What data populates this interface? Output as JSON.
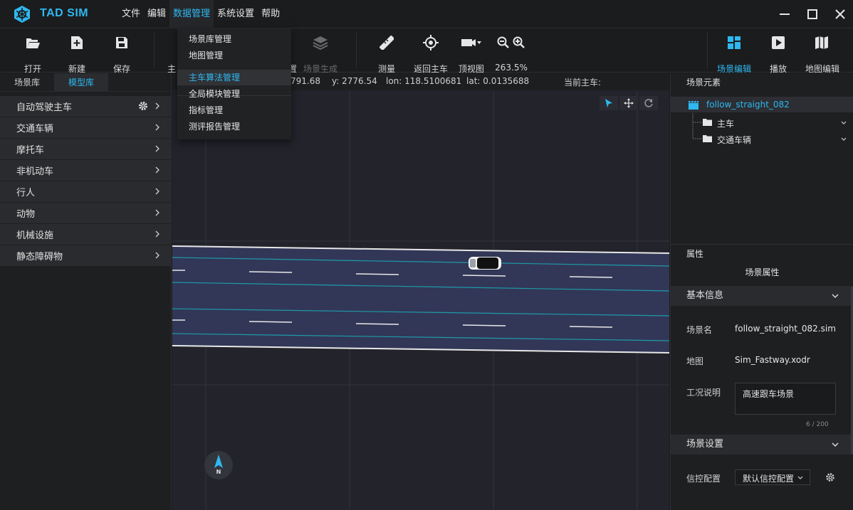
{
  "app": {
    "brand": "TAD SIM",
    "accent": "#2fb8f0"
  },
  "menubar": {
    "items": [
      "文件",
      "编辑",
      "数据管理",
      "系统设置",
      "帮助"
    ],
    "active_index": 2
  },
  "dropdown": {
    "items": [
      "场景库管理",
      "地图管理",
      "主车算法管理",
      "全局模块管理",
      "指标管理",
      "测评报告管理"
    ],
    "highlight_index": 2
  },
  "toolbar": {
    "open": "打开",
    "new": "新建",
    "save": "保存",
    "ego_partial": "主",
    "ego_partial2": "置",
    "scene_gen": "场景生成",
    "measure": "测量",
    "return_ego": "返回主车",
    "top_view": "顶视图",
    "zoom": "263.5%",
    "scene_edit": "场景编辑",
    "play": "播放",
    "map_edit": "地图编辑"
  },
  "leftpanel": {
    "tabs": [
      "场景库",
      "模型库"
    ],
    "active_tab": 1,
    "categories": [
      "自动驾驶主车",
      "交通车辆",
      "摩托车",
      "非机动车",
      "行人",
      "动物",
      "机械设施",
      "静态障碍物"
    ]
  },
  "infobar": {
    "x": "791.68",
    "y": "y: 2776.54",
    "lon": "lon: 118.5100681",
    "lat": "lat: 0.0135688",
    "ego": "当前主车:"
  },
  "compass": {
    "label": "N"
  },
  "rightpanel": {
    "elements_title": "场景元素",
    "tree": {
      "root": "follow_straight_082",
      "children": [
        "主车",
        "交通车辆"
      ]
    },
    "props_title": "属性",
    "scene_props": "场景属性",
    "basic_info": "基本信息",
    "scene_name_label": "场景名",
    "scene_name": "follow_straight_082.sim",
    "map_label": "地图",
    "map": "Sim_Fastway.xodr",
    "desc_label": "工况说明",
    "desc": "高速跟车场景",
    "desc_count": "6 / 200",
    "scene_settings": "场景设置",
    "signal_label": "信控配置",
    "signal_value": "默认信控配置"
  }
}
